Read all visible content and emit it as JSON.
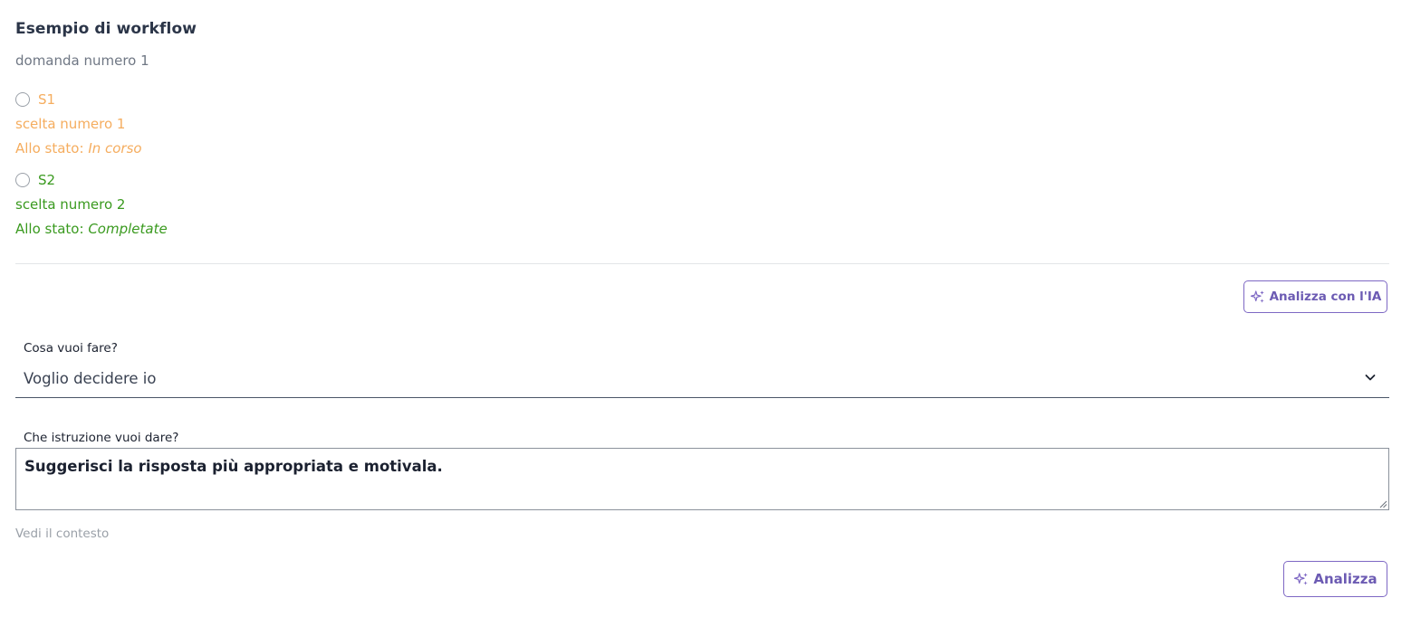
{
  "workflow": {
    "title": "Esempio di workflow",
    "question": "domanda numero 1",
    "options": [
      {
        "label": "S1",
        "description": "scelta numero 1",
        "state_prefix": "Allo stato: ",
        "state_value": "In corso",
        "color": "#f5ad5f"
      },
      {
        "label": "S2",
        "description": "scelta numero 2",
        "state_prefix": "Allo stato: ",
        "state_value": "Completate",
        "color": "#3a9a1f"
      }
    ]
  },
  "ai_panel": {
    "analyze_ai_label": "Analizza con l'IA",
    "action_label": "Cosa vuoi fare?",
    "action_value": "Voglio decidere io",
    "instruction_label": "Che istruzione vuoi dare?",
    "instruction_value": "Suggerisci la risposta più appropriata e motivala.",
    "context_link": "Vedi il contesto",
    "analyze_label": "Analizza"
  },
  "colors": {
    "accent_purple": "#7e68c4",
    "option_in_progress": "#f5ad5f",
    "option_completed": "#3a9a1f"
  },
  "icons": {
    "ai": "sparkles-icon",
    "select": "chevron-down-icon"
  }
}
